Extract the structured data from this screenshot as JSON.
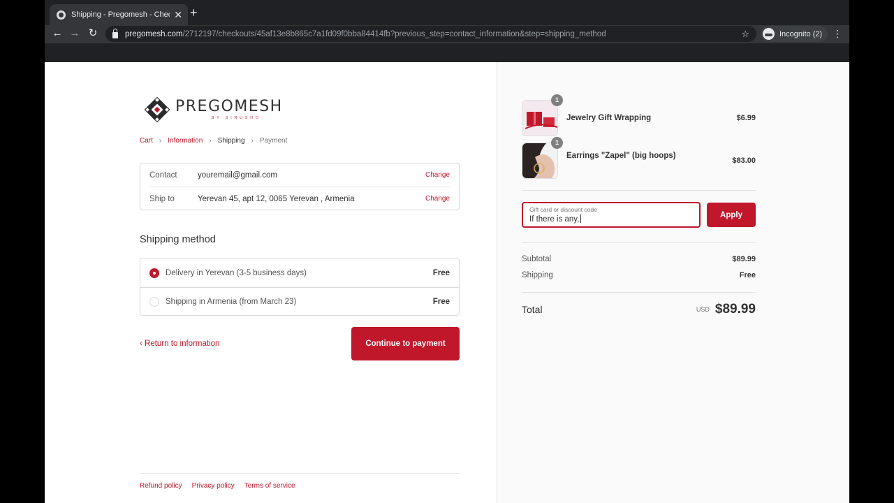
{
  "browser": {
    "tab_title": "Shipping - Pregomesh - Checkout",
    "url_host": "pregomesh.com",
    "url_path": "/2712197/checkouts/45af13e8b865c7a1fd09f0bba84414fb?previous_step=contact_information&step=shipping_method",
    "incognito_label": "Incognito (2)"
  },
  "logo": {
    "name": "PREGOMESH",
    "subtitle": "BY SIRUSHO"
  },
  "breadcrumb": [
    "Cart",
    "Information",
    "Shipping",
    "Payment"
  ],
  "review": {
    "contact_label": "Contact",
    "contact_value": "youremail@gmail.com",
    "ship_label": "Ship to",
    "ship_value": "Yerevan 45, apt 12, 0065 Yerevan , Armenia",
    "change_label": "Change"
  },
  "shipping": {
    "title": "Shipping method",
    "methods": [
      {
        "label": "Delivery in Yerevan (3-5 business days)",
        "price": "Free",
        "selected": true
      },
      {
        "label": "Shipping in Armenia (from March 23)",
        "price": "Free",
        "selected": false
      }
    ]
  },
  "actions": {
    "return_label": "Return to information",
    "continue_label": "Continue to payment"
  },
  "footer": [
    "Refund policy",
    "Privacy policy",
    "Terms of service"
  ],
  "order": {
    "items": [
      {
        "name": "Jewelry Gift Wrapping",
        "price": "$6.99",
        "qty": "1"
      },
      {
        "name": "Earrings \"Zapel\" (big hoops)",
        "price": "$83.00",
        "qty": "1"
      }
    ],
    "discount_label": "Gift card or discount code",
    "discount_value": "If there is any,",
    "apply_label": "Apply",
    "subtotal_label": "Subtotal",
    "subtotal_value": "$89.99",
    "shipping_label": "Shipping",
    "shipping_value": "Free",
    "total_label": "Total",
    "currency": "USD",
    "total_value": "$89.99"
  },
  "colors": {
    "accent": "#c0172b",
    "chrome_bg": "#202124"
  }
}
